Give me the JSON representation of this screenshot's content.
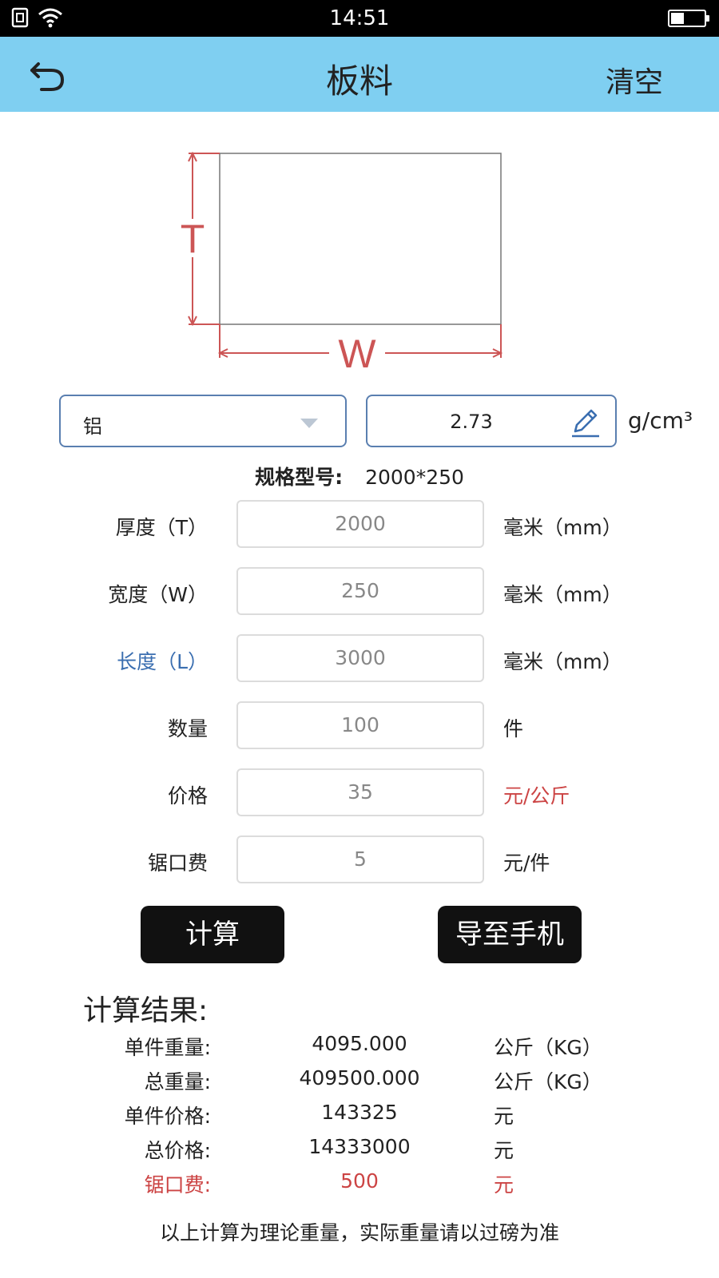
{
  "status_bar": {
    "time": "14:51"
  },
  "header": {
    "title": "板料",
    "clear_label": "清空"
  },
  "diagram": {
    "height_label": "T",
    "width_label": "W"
  },
  "material": {
    "selected": "铝",
    "density": "2.73",
    "density_unit": "g/cm³"
  },
  "spec": {
    "label": "规格型号:",
    "value": "2000*250"
  },
  "fields": [
    {
      "label": "厚度（T）",
      "value": "2000",
      "unit": "毫米（mm）"
    },
    {
      "label": "宽度（W）",
      "value": "250",
      "unit": "毫米（mm）"
    },
    {
      "label": "长度（L）",
      "value": "3000",
      "unit": "毫米（mm）"
    },
    {
      "label": "数量",
      "value": "100",
      "unit": "件"
    },
    {
      "label": "价格",
      "value": "35",
      "unit": "元/公斤"
    },
    {
      "label": "锯口费",
      "value": "5",
      "unit": "元/件"
    }
  ],
  "buttons": {
    "calculate": "计算",
    "export": "导至手机"
  },
  "results": {
    "title": "计算结果:",
    "rows": [
      {
        "label": "单件重量:",
        "value": "4095.000",
        "unit": "公斤（KG）"
      },
      {
        "label": "总重量:",
        "value": "409500.000",
        "unit": "公斤（KG）"
      },
      {
        "label": "单件价格:",
        "value": "143325",
        "unit": "元"
      },
      {
        "label": "总价格:",
        "value": "14333000",
        "unit": "元"
      },
      {
        "label": "锯口费:",
        "value": "500",
        "unit": "元"
      }
    ]
  },
  "note": "以上计算为理论重量，实际重量请以过磅为准",
  "colors": {
    "header_bg": "#7fcff1",
    "accent_red": "#cc4444",
    "accent_blue": "#3a6eb0"
  }
}
